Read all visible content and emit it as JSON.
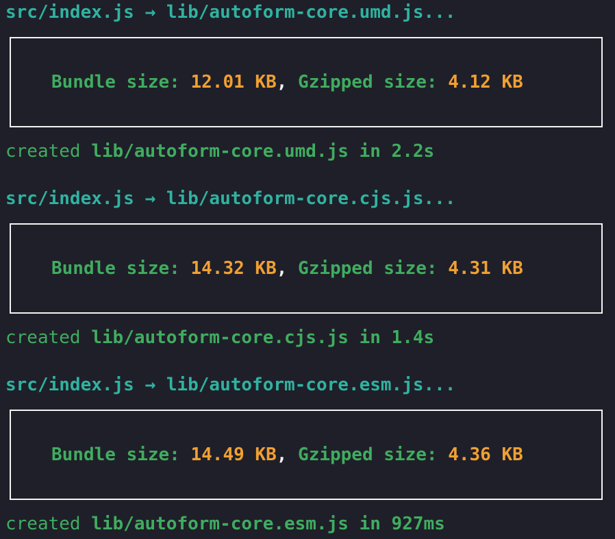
{
  "colors": {
    "background": "#1f1f29",
    "teal": "#2fb3a1",
    "green": "#3fad5f",
    "orange": "#f0a032",
    "white": "#f2f2f2"
  },
  "builds": [
    {
      "input": "src/index.js",
      "arrow": "→",
      "output": "lib/autoform-core.umd.js...",
      "bundle_label": "Bundle size: ",
      "bundle_size": "12.01 KB",
      "comma": ",",
      "gzip_label": " Gzipped size: ",
      "gzip_size": "4.12 KB",
      "created_word": "created",
      "created_file": "lib/autoform-core.umd.js",
      "in_word": "in",
      "duration": "2.2s"
    },
    {
      "input": "src/index.js",
      "arrow": "→",
      "output": "lib/autoform-core.cjs.js...",
      "bundle_label": "Bundle size: ",
      "bundle_size": "14.32 KB",
      "comma": ",",
      "gzip_label": " Gzipped size: ",
      "gzip_size": "4.31 KB",
      "created_word": "created",
      "created_file": "lib/autoform-core.cjs.js",
      "in_word": "in",
      "duration": "1.4s"
    },
    {
      "input": "src/index.js",
      "arrow": "→",
      "output": "lib/autoform-core.esm.js...",
      "bundle_label": "Bundle size: ",
      "bundle_size": "14.49 KB",
      "comma": ",",
      "gzip_label": " Gzipped size: ",
      "gzip_size": "4.36 KB",
      "created_word": "created",
      "created_file": "lib/autoform-core.esm.js",
      "in_word": "in",
      "duration": "927ms"
    }
  ]
}
